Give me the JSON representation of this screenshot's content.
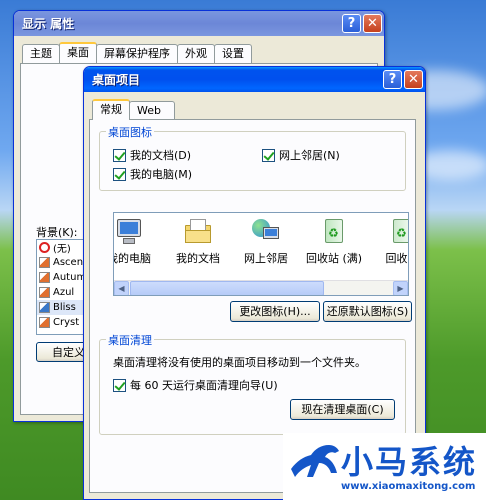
{
  "display_properties": {
    "title": "显示 属性",
    "tabs": [
      "主题",
      "桌面",
      "屏幕保护程序",
      "外观",
      "设置"
    ],
    "background_label": "背景(K):",
    "backgrounds": [
      "(无)",
      "Ascen",
      "Autum",
      "Azul",
      "Bliss",
      "Cryst"
    ],
    "customize_button": "自定义"
  },
  "desktop_items": {
    "title": "桌面项目",
    "tabs": [
      "常规",
      "Web"
    ],
    "desktop_icons_group": "桌面图标",
    "checkboxes": {
      "my_documents": "我的文档(D)",
      "network_places": "网上邻居(N)",
      "my_computer": "我的电脑(M)"
    },
    "icon_list": [
      "我的电脑",
      "我的文档",
      "网上邻居",
      "回收站 (满)",
      "回收站"
    ],
    "change_icon_button": "更改图标(H)...",
    "restore_default_button": "还原默认图标(S)",
    "cleanup_group": "桌面清理",
    "cleanup_description": "桌面清理将没有使用的桌面项目移动到一个文件夹。",
    "cleanup_checkbox": "每 60 天运行桌面清理向导(U)",
    "cleanup_now_button": "现在清理桌面(C)"
  },
  "watermark": {
    "brand": "小马系统",
    "url": "www.xiaomaxitong.com"
  },
  "colors": {
    "title_blue": "#0053ee",
    "group_label_blue": "#0046d5",
    "close_red": "#c5401d",
    "checkmark_green": "#21a121"
  }
}
